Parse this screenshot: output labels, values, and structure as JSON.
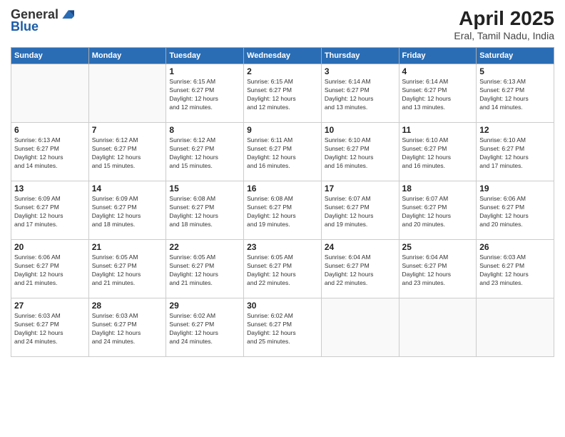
{
  "logo": {
    "general": "General",
    "blue": "Blue"
  },
  "header": {
    "month": "April 2025",
    "location": "Eral, Tamil Nadu, India"
  },
  "weekdays": [
    "Sunday",
    "Monday",
    "Tuesday",
    "Wednesday",
    "Thursday",
    "Friday",
    "Saturday"
  ],
  "days": [
    {
      "date": null,
      "number": "",
      "info": ""
    },
    {
      "date": null,
      "number": "",
      "info": ""
    },
    {
      "number": "1",
      "info": "Sunrise: 6:15 AM\nSunset: 6:27 PM\nDaylight: 12 hours\nand 12 minutes."
    },
    {
      "number": "2",
      "info": "Sunrise: 6:15 AM\nSunset: 6:27 PM\nDaylight: 12 hours\nand 12 minutes."
    },
    {
      "number": "3",
      "info": "Sunrise: 6:14 AM\nSunset: 6:27 PM\nDaylight: 12 hours\nand 13 minutes."
    },
    {
      "number": "4",
      "info": "Sunrise: 6:14 AM\nSunset: 6:27 PM\nDaylight: 12 hours\nand 13 minutes."
    },
    {
      "number": "5",
      "info": "Sunrise: 6:13 AM\nSunset: 6:27 PM\nDaylight: 12 hours\nand 14 minutes."
    },
    {
      "number": "6",
      "info": "Sunrise: 6:13 AM\nSunset: 6:27 PM\nDaylight: 12 hours\nand 14 minutes."
    },
    {
      "number": "7",
      "info": "Sunrise: 6:12 AM\nSunset: 6:27 PM\nDaylight: 12 hours\nand 15 minutes."
    },
    {
      "number": "8",
      "info": "Sunrise: 6:12 AM\nSunset: 6:27 PM\nDaylight: 12 hours\nand 15 minutes."
    },
    {
      "number": "9",
      "info": "Sunrise: 6:11 AM\nSunset: 6:27 PM\nDaylight: 12 hours\nand 16 minutes."
    },
    {
      "number": "10",
      "info": "Sunrise: 6:10 AM\nSunset: 6:27 PM\nDaylight: 12 hours\nand 16 minutes."
    },
    {
      "number": "11",
      "info": "Sunrise: 6:10 AM\nSunset: 6:27 PM\nDaylight: 12 hours\nand 16 minutes."
    },
    {
      "number": "12",
      "info": "Sunrise: 6:10 AM\nSunset: 6:27 PM\nDaylight: 12 hours\nand 17 minutes."
    },
    {
      "number": "13",
      "info": "Sunrise: 6:09 AM\nSunset: 6:27 PM\nDaylight: 12 hours\nand 17 minutes."
    },
    {
      "number": "14",
      "info": "Sunrise: 6:09 AM\nSunset: 6:27 PM\nDaylight: 12 hours\nand 18 minutes."
    },
    {
      "number": "15",
      "info": "Sunrise: 6:08 AM\nSunset: 6:27 PM\nDaylight: 12 hours\nand 18 minutes."
    },
    {
      "number": "16",
      "info": "Sunrise: 6:08 AM\nSunset: 6:27 PM\nDaylight: 12 hours\nand 19 minutes."
    },
    {
      "number": "17",
      "info": "Sunrise: 6:07 AM\nSunset: 6:27 PM\nDaylight: 12 hours\nand 19 minutes."
    },
    {
      "number": "18",
      "info": "Sunrise: 6:07 AM\nSunset: 6:27 PM\nDaylight: 12 hours\nand 20 minutes."
    },
    {
      "number": "19",
      "info": "Sunrise: 6:06 AM\nSunset: 6:27 PM\nDaylight: 12 hours\nand 20 minutes."
    },
    {
      "number": "20",
      "info": "Sunrise: 6:06 AM\nSunset: 6:27 PM\nDaylight: 12 hours\nand 21 minutes."
    },
    {
      "number": "21",
      "info": "Sunrise: 6:05 AM\nSunset: 6:27 PM\nDaylight: 12 hours\nand 21 minutes."
    },
    {
      "number": "22",
      "info": "Sunrise: 6:05 AM\nSunset: 6:27 PM\nDaylight: 12 hours\nand 21 minutes."
    },
    {
      "number": "23",
      "info": "Sunrise: 6:05 AM\nSunset: 6:27 PM\nDaylight: 12 hours\nand 22 minutes."
    },
    {
      "number": "24",
      "info": "Sunrise: 6:04 AM\nSunset: 6:27 PM\nDaylight: 12 hours\nand 22 minutes."
    },
    {
      "number": "25",
      "info": "Sunrise: 6:04 AM\nSunset: 6:27 PM\nDaylight: 12 hours\nand 23 minutes."
    },
    {
      "number": "26",
      "info": "Sunrise: 6:03 AM\nSunset: 6:27 PM\nDaylight: 12 hours\nand 23 minutes."
    },
    {
      "number": "27",
      "info": "Sunrise: 6:03 AM\nSunset: 6:27 PM\nDaylight: 12 hours\nand 24 minutes."
    },
    {
      "number": "28",
      "info": "Sunrise: 6:03 AM\nSunset: 6:27 PM\nDaylight: 12 hours\nand 24 minutes."
    },
    {
      "number": "29",
      "info": "Sunrise: 6:02 AM\nSunset: 6:27 PM\nDaylight: 12 hours\nand 24 minutes."
    },
    {
      "number": "30",
      "info": "Sunrise: 6:02 AM\nSunset: 6:27 PM\nDaylight: 12 hours\nand 25 minutes."
    },
    {
      "date": null,
      "number": "",
      "info": ""
    },
    {
      "date": null,
      "number": "",
      "info": ""
    },
    {
      "date": null,
      "number": "",
      "info": ""
    }
  ]
}
